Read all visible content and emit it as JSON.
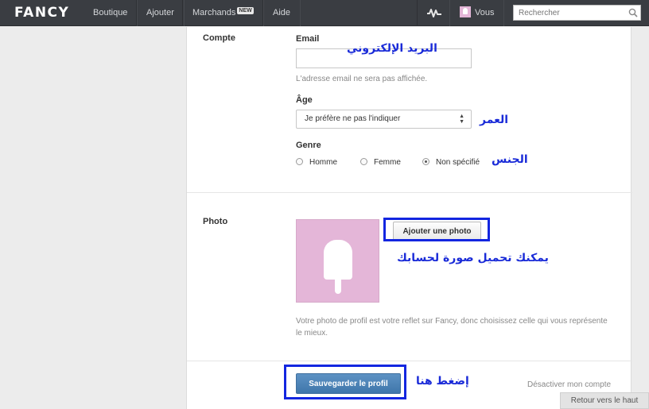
{
  "nav": {
    "logo": "FANCY",
    "items": [
      {
        "label": "Boutique"
      },
      {
        "label": "Ajouter"
      },
      {
        "label": "Marchands",
        "badge": "NEW"
      },
      {
        "label": "Aide"
      }
    ],
    "activity_icon": "activity-icon",
    "user_label": "Vous",
    "search_placeholder": "Rechercher"
  },
  "account": {
    "section_title": "Compte",
    "email_label": "Email",
    "email_value": "",
    "email_help": "L'adresse email ne sera pas affichée.",
    "age_label": "Âge",
    "age_selected": "Je préfère ne pas l'indiquer",
    "gender_label": "Genre",
    "gender_options": [
      {
        "label": "Homme",
        "checked": false
      },
      {
        "label": "Femme",
        "checked": false
      },
      {
        "label": "Non spécifié",
        "checked": true
      }
    ]
  },
  "photo": {
    "section_title": "Photo",
    "add_button": "Ajouter une photo",
    "help": "Votre photo de profil est votre reflet sur Fancy, donc choisissez celle qui vous représente le mieux."
  },
  "actions": {
    "save_button": "Sauvegarder le profil",
    "deactivate_link": "Désactiver mon compte"
  },
  "annotations": {
    "email": "البريد الإلكتروني",
    "age": "العمر",
    "gender": "الجنس",
    "photo": "يمكنك تحميل صورة لحسابك",
    "save": "إضغط هنا"
  },
  "back_to_top": "Retour vers le haut",
  "colors": {
    "topbar": "#3a3d42",
    "primary_button": "#4a82b8",
    "annotation": "#1326e0",
    "photo_placeholder": "#e4b6d8"
  }
}
